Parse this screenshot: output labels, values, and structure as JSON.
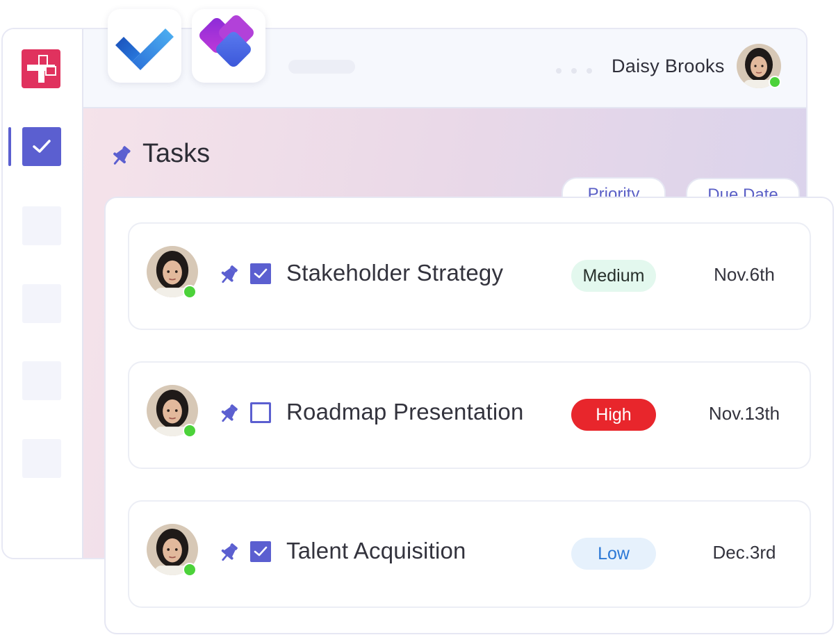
{
  "header": {
    "user_name": "Daisy Brooks"
  },
  "page": {
    "title": "Tasks"
  },
  "columns": {
    "priority": "Priority",
    "due_date": "Due Date"
  },
  "tasks": [
    {
      "title": "Stakeholder Strategy",
      "checked": true,
      "priority": "Medium",
      "due": "Nov.6th"
    },
    {
      "title": "Roadmap Presentation",
      "checked": false,
      "priority": "High",
      "due": "Nov.13th"
    },
    {
      "title": "Talent Acquisition",
      "checked": true,
      "priority": "Low",
      "due": "Dec.3rd"
    }
  ],
  "colors": {
    "accent": "#5b5fd0",
    "brand": "#e0325e",
    "online": "#4cd23a",
    "medium_bg": "#e3f8ee",
    "high_bg": "#e8262c",
    "low_bg": "#e6f1fc",
    "low_text": "#2b78d6"
  },
  "icons": {
    "app_logo": "app-logo-icon",
    "todo": "microsoft-todo-icon",
    "planner": "microsoft-planner-icon",
    "pin": "pin-icon"
  }
}
